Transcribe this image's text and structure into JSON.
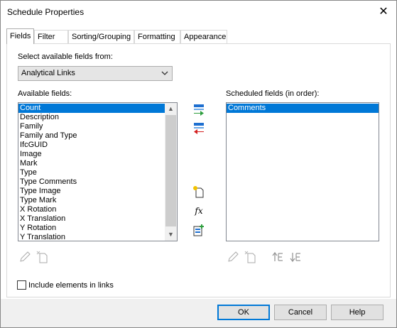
{
  "window": {
    "title": "Schedule Properties",
    "close_glyph": "✕"
  },
  "tabs": [
    {
      "label": "Fields",
      "active": true
    },
    {
      "label": "Filter"
    },
    {
      "label": "Sorting/Grouping"
    },
    {
      "label": "Formatting"
    },
    {
      "label": "Appearance"
    }
  ],
  "fields": {
    "select_from_label": "Select available fields from:",
    "select_from_value": "Analytical Links",
    "available_label": "Available fields:",
    "available_items": [
      "Count",
      "Description",
      "Family",
      "Family and Type",
      "IfcGUID",
      "Image",
      "Mark",
      "Type",
      "Type Comments",
      "Type Image",
      "Type Mark",
      "X Rotation",
      "X Translation",
      "Y Rotation",
      "Y Translation"
    ],
    "available_selected": "Count",
    "scheduled_label": "Scheduled fields (in order):",
    "scheduled_items": [
      "Comments"
    ],
    "scheduled_selected": "Comments",
    "include_links_label": "Include elements in links",
    "include_links_checked": false,
    "formula_glyph": "fx"
  },
  "icons": {
    "add": "add-field-arrow-icon",
    "remove": "remove-field-arrow-icon",
    "new_parameter": "new-parameter-icon",
    "calculated": "calculated-value-fx-icon",
    "combine": "combine-parameters-icon",
    "edit": "edit-pencil-icon",
    "delete": "delete-parameter-icon",
    "move_up": "move-up-icon",
    "move_down": "move-down-icon"
  },
  "colors": {
    "selection": "#0078d7",
    "accent_green": "#2e9e3e",
    "accent_red": "#d42020"
  },
  "buttons": {
    "ok": "OK",
    "cancel": "Cancel",
    "help": "Help"
  }
}
